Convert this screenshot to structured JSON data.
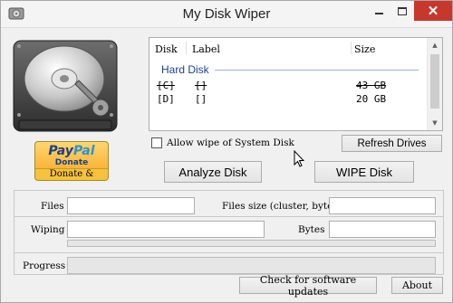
{
  "window": {
    "title": "My Disk Wiper"
  },
  "paypal": {
    "logo_pay": "Pay",
    "logo_pal": "Pal",
    "donate_label": "Donate",
    "register_label": "Donate & register"
  },
  "disk_list": {
    "columns": [
      "Disk",
      "Label",
      "Size"
    ],
    "group": "Hard Disk",
    "rows": [
      {
        "disk": "[C]",
        "label": "[]",
        "size": "43 GB",
        "disabled": true
      },
      {
        "disk": "[D]",
        "label": "[]",
        "size": "20 GB",
        "disabled": false
      }
    ]
  },
  "options": {
    "allow_system_wipe_label": "Allow wipe of System Disk",
    "allow_system_wipe_checked": false
  },
  "buttons": {
    "refresh": "Refresh Drives",
    "analyze": "Analyze Disk",
    "wipe": "WIPE Disk",
    "updates": "Check for software updates",
    "about": "About"
  },
  "info": {
    "files_label": "Files",
    "files_value": "",
    "files_size_label": "Files size (cluster, bytes)",
    "files_size_value": "",
    "wiping_label": "Wiping",
    "wiping_value": "",
    "bytes_label": "Bytes",
    "bytes_value": "",
    "wiping_progress": 0,
    "progress_label": "Progress",
    "progress": 0
  },
  "colors": {
    "close_button": "#c7372c",
    "group_text": "#1c3f95",
    "progress_fill": "#06b025"
  },
  "icons": [
    "app-icon",
    "minimize-icon",
    "maximize-icon",
    "close-icon",
    "hard-disk-illustration",
    "mouse-cursor"
  ]
}
